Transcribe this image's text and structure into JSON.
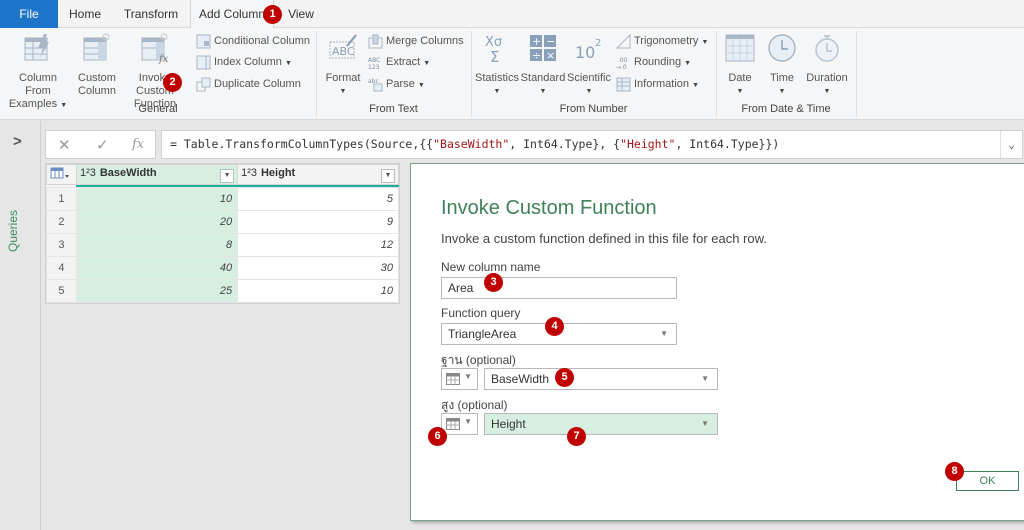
{
  "tabs": [
    {
      "label": "File"
    },
    {
      "label": "Home"
    },
    {
      "label": "Transform"
    },
    {
      "label": "Add Column",
      "active": true
    },
    {
      "label": "View"
    }
  ],
  "ribbon": {
    "general": {
      "label": "General",
      "column_from_examples": [
        "Column From",
        "Examples"
      ],
      "custom_column": [
        "Custom",
        "Column"
      ],
      "invoke_custom_function": [
        "Invoke Custom",
        "Function"
      ],
      "conditional_column": "Conditional Column",
      "index_column": "Index Column",
      "duplicate_column": "Duplicate Column"
    },
    "from_text": {
      "label": "From Text",
      "format": "Format",
      "merge_columns": "Merge Columns",
      "extract": "Extract",
      "parse": "Parse"
    },
    "from_number": {
      "label": "From Number",
      "statistics": "Statistics",
      "standard": "Standard",
      "scientific": "Scientific",
      "trigonometry": "Trigonometry",
      "rounding": "Rounding",
      "information": "Information"
    },
    "from_date_time": {
      "label": "From Date & Time",
      "date": "Date",
      "time": "Time",
      "duration": "Duration"
    }
  },
  "left_pane": {
    "label": "Queries"
  },
  "formula_bar": {
    "prefix": "= Table.TransformColumnTypes(Source,{{",
    "s1": "\"BaseWidth\"",
    "mid": ", Int64.Type}, {",
    "s2": "\"Height\"",
    "suffix": ", Int64.Type}})"
  },
  "grid": {
    "columns": [
      {
        "type": "1²3",
        "name": "BaseWidth"
      },
      {
        "type": "1²3",
        "name": "Height"
      }
    ],
    "rows": [
      {
        "n": "1",
        "BaseWidth": "10",
        "Height": "5"
      },
      {
        "n": "2",
        "BaseWidth": "20",
        "Height": "9"
      },
      {
        "n": "3",
        "BaseWidth": "8",
        "Height": "12"
      },
      {
        "n": "4",
        "BaseWidth": "40",
        "Height": "30"
      },
      {
        "n": "5",
        "BaseWidth": "25",
        "Height": "10"
      }
    ]
  },
  "dialog": {
    "title": "Invoke Custom Function",
    "description": "Invoke a custom function defined in this file for each row.",
    "new_column_label": "New column name",
    "new_column_value": "Area",
    "function_query_label": "Function query",
    "function_query_value": "TriangleArea",
    "param1_label": "ฐาน (optional)",
    "param1_value": "BaseWidth",
    "param2_label": "สูง (optional)",
    "param2_value": "Height",
    "ok_label": "OK"
  },
  "badges": [
    "1",
    "2",
    "3",
    "4",
    "5",
    "6",
    "7",
    "8"
  ],
  "colors": {
    "accent_green": "#3f8259",
    "file_tab": "#1e74c8",
    "badge": "#c00000",
    "selected_col": "#d6efe1"
  }
}
